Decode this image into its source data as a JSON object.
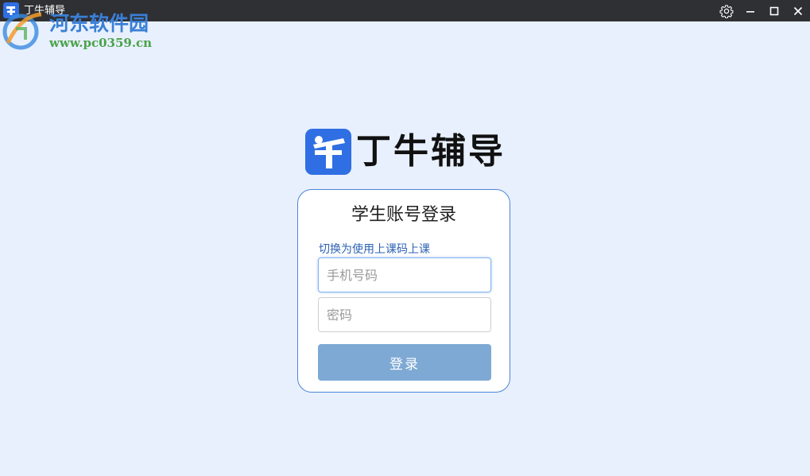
{
  "window": {
    "title": "丁牛辅导",
    "settings_icon": "gear-icon",
    "minimize_icon": "minimize-icon",
    "maximize_icon": "maximize-icon",
    "close_icon": "close-icon"
  },
  "watermark": {
    "name": "河东软件园",
    "url": "www.pc0359.cn"
  },
  "brand": {
    "name": "丁牛辅导",
    "logo_color": "#2f6fe3"
  },
  "login": {
    "title": "学生账号登录",
    "switch_link": "切换为使用上课码上课",
    "phone_placeholder": "手机号码",
    "password_placeholder": "密码",
    "submit_label": "登录"
  },
  "colors": {
    "background": "#e8f0fe",
    "titlebar": "#2f3033",
    "accent": "#4a86d8",
    "button": "#7ea9d4",
    "link": "#2d62b4"
  }
}
